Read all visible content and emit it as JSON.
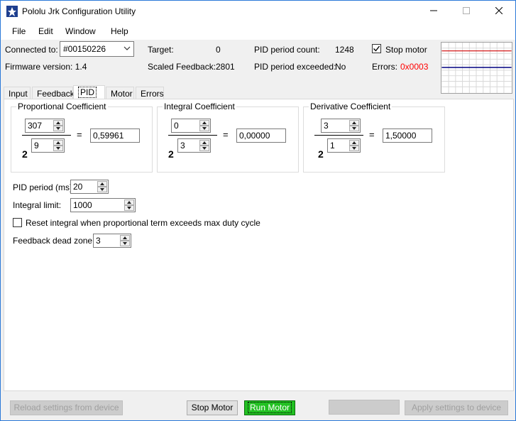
{
  "window": {
    "title": "Pololu Jrk Configuration Utility",
    "controls": {
      "minimize": "—",
      "maximize": "☐",
      "close": "✕"
    }
  },
  "menu": [
    {
      "label": "File"
    },
    {
      "label": "Edit"
    },
    {
      "label": "Window"
    },
    {
      "label": "Help"
    }
  ],
  "status": {
    "connected_label": "Connected to:",
    "connected_value": "#00150226",
    "firmware_label": "Firmware version:",
    "firmware_value": "1.4",
    "target_label": "Target:",
    "target_value": "0",
    "scaled_feedback_label": "Scaled Feedback:",
    "scaled_feedback_value": "2801",
    "pid_period_count_label": "PID period count:",
    "pid_period_count_value": "1248",
    "pid_period_exceeded_label": "PID period exceeded:",
    "pid_period_exceeded_value": "No",
    "stop_motor_label": "Stop motor",
    "stop_motor_checked": true,
    "errors_label": "Errors:",
    "errors_value": "0x0003",
    "errors_color": "#ff0000"
  },
  "tabs": [
    {
      "label": "Input"
    },
    {
      "label": "Feedback"
    },
    {
      "label": "PID"
    },
    {
      "label": "Motor"
    },
    {
      "label": "Errors"
    }
  ],
  "pid": {
    "proportional": {
      "title": "Proportional Coefficient",
      "multiplier": "307",
      "exponent": "9",
      "base": "2",
      "equals": "=",
      "result": "0,59961"
    },
    "integral": {
      "title": "Integral Coefficient",
      "multiplier": "0",
      "exponent": "3",
      "base": "2",
      "equals": "=",
      "result": "0,00000"
    },
    "derivative": {
      "title": "Derivative Coefficient",
      "multiplier": "3",
      "exponent": "1",
      "base": "2",
      "equals": "=",
      "result": "1,50000"
    },
    "period_label": "PID period (ms):",
    "period_value": "20",
    "integral_limit_label": "Integral limit:",
    "integral_limit_value": "1000",
    "reset_integral_label": "Reset integral when proportional term exceeds max duty cycle",
    "reset_integral_checked": false,
    "dead_zone_label": "Feedback dead zone:",
    "dead_zone_value": "3"
  },
  "buttons": {
    "reload": "Reload settings from device",
    "stop_motor": "Stop Motor",
    "run_motor": "Run Motor",
    "blank": "",
    "apply": "Apply settings to device"
  },
  "colors": {
    "run_motor_bg": "#22c022",
    "graph_red": "#d00000",
    "graph_blue": "#000080"
  }
}
